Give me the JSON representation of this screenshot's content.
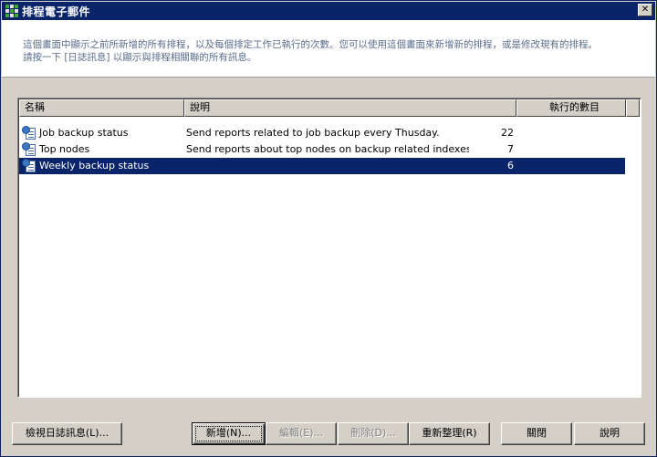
{
  "window": {
    "title": "排程電子郵件",
    "close_label": "✕"
  },
  "header": {
    "description_line1": "這個畫面中顯示之前所新增的所有排程，以及每個排定工作已執行的次數。您可以使用這個畫面來新增新的排程，或是修改現有的排程。",
    "description_line2": "請按一下 [日誌訊息] 以顯示與排程相關聯的所有訊息。"
  },
  "table": {
    "columns": [
      "名稱",
      "說明",
      "執行的數目"
    ],
    "rows": [
      {
        "name": "Job backup status",
        "description": "Send reports related to job backup every Thusday.",
        "count": "22",
        "selected": false
      },
      {
        "name": "Top nodes",
        "description": "Send reports about top nodes on backup related indexes every da",
        "count": "7",
        "selected": false
      },
      {
        "name": "Weekly backup status",
        "description": "",
        "count": "6",
        "selected": true
      }
    ]
  },
  "buttons": {
    "view_log": "檢視日誌訊息(L)...",
    "add": "新增(N)...",
    "edit": "編輯(E)...",
    "delete": "刪除(D)...",
    "refresh": "重新整理(R)",
    "close": "關閉",
    "help": "說明"
  },
  "colors": {
    "titlebar": "#0a246a",
    "selection": "#0a246a",
    "header_text": "#5a6e8c",
    "face": "#d4d0c8"
  },
  "icons": {
    "app": "scheduler-grid-icon",
    "row": "scheduled-task-icon"
  }
}
